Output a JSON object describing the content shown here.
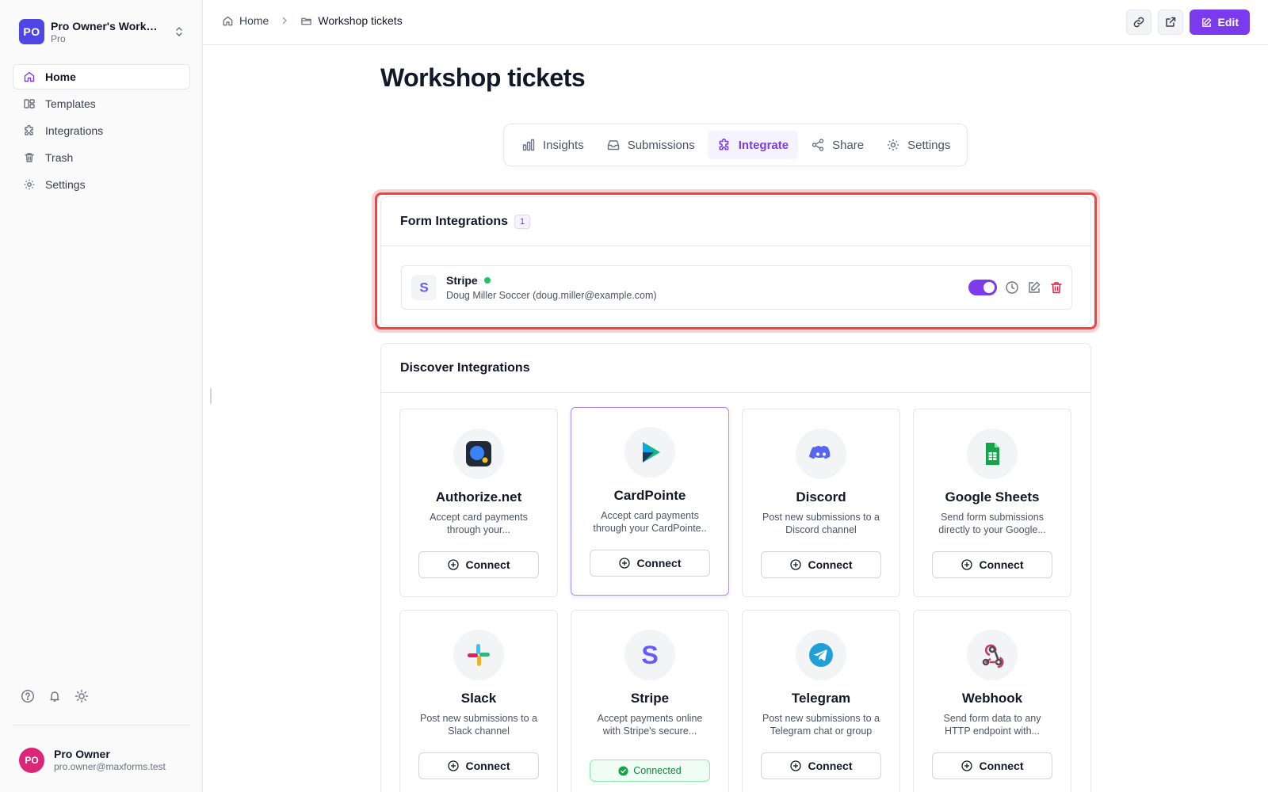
{
  "workspace": {
    "initials": "PO",
    "name": "Pro Owner's Workspace",
    "plan": "Pro"
  },
  "sidebar": {
    "items": [
      {
        "label": "Home",
        "icon": "home-icon"
      },
      {
        "label": "Templates",
        "icon": "templates-icon"
      },
      {
        "label": "Integrations",
        "icon": "puzzle-icon"
      },
      {
        "label": "Trash",
        "icon": "trash-icon"
      },
      {
        "label": "Settings",
        "icon": "gear-icon"
      }
    ],
    "active": "Home"
  },
  "user": {
    "initials": "PO",
    "name": "Pro Owner",
    "email": "pro.owner@maxforms.test"
  },
  "breadcrumb": {
    "home": "Home",
    "current": "Workshop tickets"
  },
  "toolbar": {
    "edit_label": "Edit"
  },
  "page": {
    "title": "Workshop tickets"
  },
  "tabs": [
    {
      "label": "Insights",
      "icon": "bar-chart-icon"
    },
    {
      "label": "Submissions",
      "icon": "inbox-icon"
    },
    {
      "label": "Integrate",
      "icon": "puzzle-icon",
      "active": true
    },
    {
      "label": "Share",
      "icon": "share-icon"
    },
    {
      "label": "Settings",
      "icon": "gear-icon"
    }
  ],
  "form_integrations": {
    "title": "Form Integrations",
    "count": "1",
    "items": [
      {
        "name": "Stripe",
        "account": "Doug Miller Soccer (doug.miller@example.com)",
        "status": "active",
        "enabled": true
      }
    ]
  },
  "discover": {
    "title": "Discover Integrations",
    "tiles": [
      {
        "name": "Authorize.net",
        "desc": "Accept card payments through your...",
        "button": "Connect",
        "icon": "authorize-net-icon"
      },
      {
        "name": "CardPointe",
        "desc": "Accept card payments through your CardPointe..",
        "button": "Connect",
        "icon": "cardpointe-icon"
      },
      {
        "name": "Discord",
        "desc": "Post new submissions to a Discord channel",
        "button": "Connect",
        "icon": "discord-icon"
      },
      {
        "name": "Google Sheets",
        "desc": "Send form submissions directly to your Google...",
        "button": "Connect",
        "icon": "google-sheets-icon"
      },
      {
        "name": "Slack",
        "desc": "Post new submissions to a Slack channel",
        "button": "Connect",
        "icon": "slack-icon"
      },
      {
        "name": "Stripe",
        "desc": "Accept payments online with Stripe's secure...",
        "button": "Connected",
        "icon": "stripe-icon"
      },
      {
        "name": "Telegram",
        "desc": "Post new submissions to a Telegram chat or group",
        "button": "Connect",
        "icon": "telegram-icon"
      },
      {
        "name": "Webhook",
        "desc": "Send form data to any HTTP endpoint with...",
        "button": "Connect",
        "icon": "webhook-icon"
      }
    ]
  },
  "colors": {
    "accent": "#7c3aed",
    "highlight": "#ef4444",
    "success": "#22c55e"
  }
}
